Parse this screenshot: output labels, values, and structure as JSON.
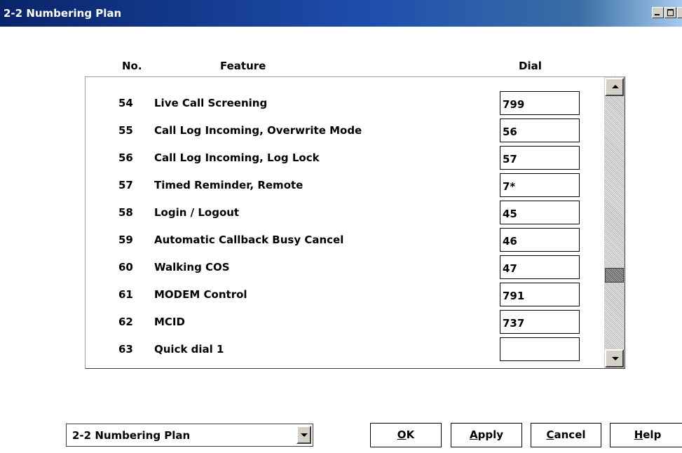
{
  "window": {
    "title": "2-2 Numbering Plan",
    "controls": [
      "minimize-icon",
      "maximize-icon"
    ]
  },
  "table": {
    "headers": {
      "no": "No.",
      "feature": "Feature",
      "dial": "Dial"
    },
    "rows": [
      {
        "no": "54",
        "feature": "Live Call Screening",
        "dial": "799"
      },
      {
        "no": "55",
        "feature": "Call Log Incoming, Overwrite Mode",
        "dial": "56"
      },
      {
        "no": "56",
        "feature": "Call Log Incoming, Log Lock",
        "dial": "57"
      },
      {
        "no": "57",
        "feature": "Timed Reminder, Remote",
        "dial": "7*"
      },
      {
        "no": "58",
        "feature": "Login / Logout",
        "dial": "45"
      },
      {
        "no": "59",
        "feature": "Automatic Callback Busy Cancel",
        "dial": "46"
      },
      {
        "no": "60",
        "feature": "Walking COS",
        "dial": "47"
      },
      {
        "no": "61",
        "feature": "MODEM Control",
        "dial": "791"
      },
      {
        "no": "62",
        "feature": "MCID",
        "dial": "737"
      },
      {
        "no": "63",
        "feature": "Quick dial 1",
        "dial": ""
      }
    ],
    "scroll_position": 0.72
  },
  "footer": {
    "combo_value": "2-2 Numbering Plan",
    "buttons": {
      "ok": {
        "mnemonic": "O",
        "rest": "K"
      },
      "apply": {
        "mnemonic": "A",
        "rest": "pply"
      },
      "cancel": {
        "mnemonic": "C",
        "rest": "ancel"
      },
      "help": {
        "mnemonic": "H",
        "rest": "elp"
      }
    }
  }
}
